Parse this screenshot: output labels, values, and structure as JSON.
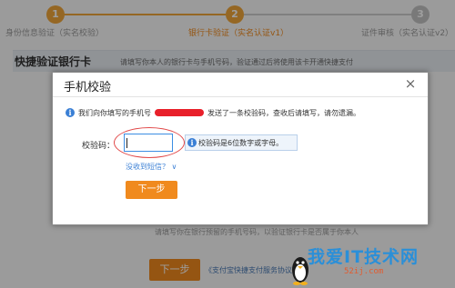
{
  "steps": [
    {
      "num": "1",
      "label": "身份信息验证（实名校验）",
      "state": "done"
    },
    {
      "num": "2",
      "label": "银行卡验证（实名认证v1）",
      "state": "current"
    },
    {
      "num": "3",
      "label": "证件审核（实名认证v2）",
      "state": "todo"
    }
  ],
  "section": {
    "title": "快捷验证银行卡",
    "description": "请填写你本人的银行卡与手机号码，验证通过后将使用该卡开通快捷支付"
  },
  "background": {
    "hint": "请填写你在银行预留的手机号码，以验证银行卡是否属于你本人",
    "next_label": "下一步",
    "agreement": "《支付宝快捷支付服务协议》"
  },
  "modal": {
    "title": "手机校验",
    "close_label": "×",
    "notice_prefix": "我们向你填写的手机号",
    "notice_suffix": "发送了一条校验码，查收后请填写，请勿遗漏。",
    "code_label": "校验码：",
    "code_value": "",
    "code_tip": "校验码是6位数字或字母。",
    "sms_link": "没收到短信？ ∨",
    "next_label": "下一步"
  },
  "watermark": {
    "text": "我爱IT技术网",
    "url": "52ij.com"
  },
  "colors": {
    "accent_orange": "#f08a1e",
    "link_blue": "#3a7fd5",
    "annotation_red": "#e14848"
  },
  "icons": {
    "info": "info-icon",
    "close": "close-icon"
  }
}
